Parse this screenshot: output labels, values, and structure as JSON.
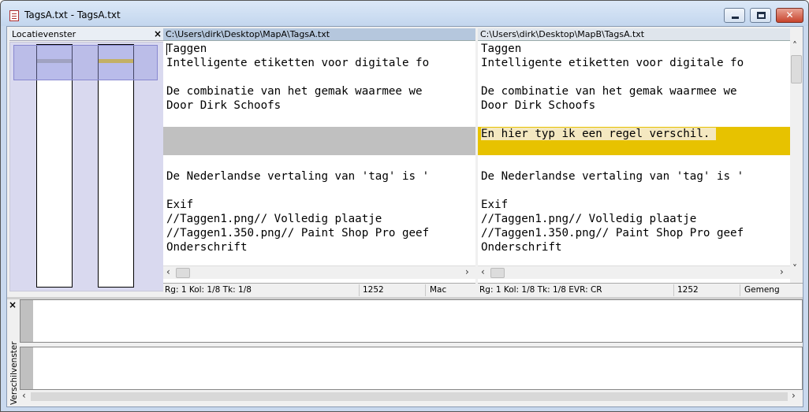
{
  "window": {
    "title": "TagsA.txt - TagsA.txt",
    "buttons": {
      "minimize": "–",
      "maximize": "□",
      "close": "✕"
    }
  },
  "location_pane": {
    "title": "Locatievenster",
    "close_glyph": "×",
    "marks": {
      "left_color": "#a8a8a8",
      "right_color": "#e7c200"
    }
  },
  "pane_a": {
    "path": "C:\\Users\\dirk\\Desktop\\MapA\\TagsA.txt",
    "lines": [
      "Taggen",
      "Intelligente etiketten voor digitale fo",
      "",
      "De combinatie van het gemak waarmee we",
      "Door Dirk Schoofs",
      "",
      "",
      "",
      "",
      "De Nederlandse vertaling van 'tag' is '",
      "",
      "Exif",
      "//Taggen1.png// Volledig plaatje",
      "//Taggen1.350.png// Paint Shop Pro geef",
      "Onderschrift"
    ],
    "status": {
      "pos": "Rg: 1  Kol: 1/8  Tk: 1/8",
      "size": "1252",
      "eol": "Mac"
    }
  },
  "pane_b": {
    "path": "C:\\Users\\dirk\\Desktop\\MapB\\TagsA.txt",
    "lines": [
      "Taggen",
      "Intelligente etiketten voor digitale fo",
      "",
      "De combinatie van het gemak waarmee we",
      "Door Dirk Schoofs",
      "",
      "En hier typ ik een regel verschil.",
      "",
      "",
      "De Nederlandse vertaling van 'tag' is '",
      "",
      "Exif",
      "//Taggen1.png// Volledig plaatje",
      "//Taggen1.350.png// Paint Shop Pro geef",
      "Onderschrift"
    ],
    "status": {
      "pos": "Rg: 1  Kol: 1/8  Tk: 1/8  EVR: CR",
      "size": "1252",
      "encoding": "Gemeng"
    }
  },
  "diff_pane": {
    "label": "Verschilvenster",
    "close_glyph": "×"
  },
  "colors": {
    "added_line": "#e7c200",
    "missing_line": "#c0c0c0",
    "active_header": "#b5c7dd"
  }
}
